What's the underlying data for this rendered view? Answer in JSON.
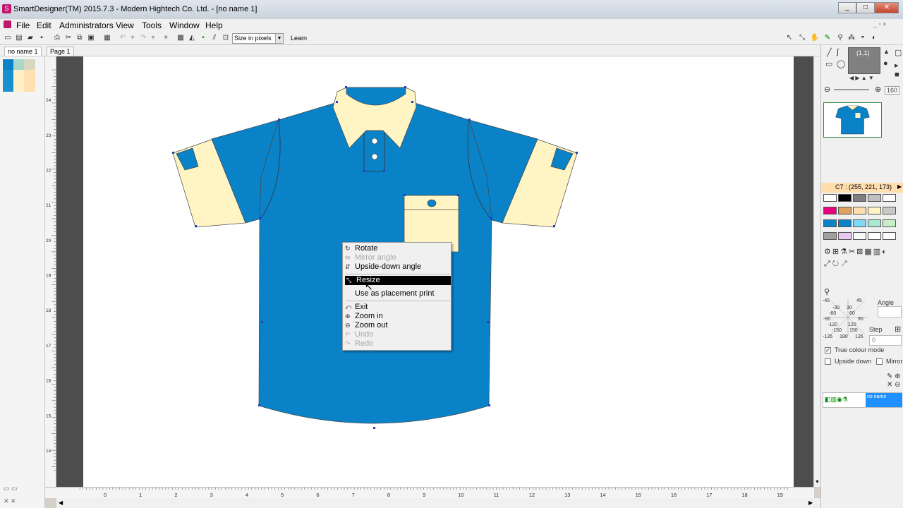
{
  "window": {
    "title": "SmartDesigner(TM) 2015.7.3 - Modern Hightech Co. Ltd. - [no name 1]",
    "controls": [
      "_",
      "□",
      "✕"
    ]
  },
  "menubar": [
    "File",
    "Edit",
    "Administrators",
    "View",
    "Tools",
    "Window",
    "Help"
  ],
  "toolbar": {
    "size_mode": "Size in pixels",
    "learn": "Learn"
  },
  "tabs": [
    "no name 1",
    "Page 1"
  ],
  "rulers": {
    "horizontal": [
      "0",
      "1",
      "2",
      "3",
      "4",
      "5",
      "6",
      "7",
      "8",
      "9",
      "10",
      "11",
      "12",
      "13",
      "14",
      "15",
      "16",
      "17",
      "18",
      "19"
    ],
    "vertical": [
      "24",
      "23",
      "22",
      "21",
      "20",
      "19",
      "18",
      "17",
      "16",
      "15",
      "14"
    ]
  },
  "context_menu": {
    "items": [
      {
        "label": "Rotate",
        "icon": "rotate-icon",
        "disabled": false
      },
      {
        "label": "Mirror angle",
        "icon": "mirror-icon",
        "disabled": true
      },
      {
        "label": "Upside-down angle",
        "icon": "upside-down-icon",
        "disabled": false
      },
      {
        "label": "Resize",
        "icon": "resize-icon",
        "disabled": false,
        "selected": true
      },
      {
        "label": "Use as placement print",
        "icon": "",
        "disabled": false
      },
      {
        "label": "Exit",
        "icon": "exit-icon",
        "disabled": false
      },
      {
        "label": "Zoom in",
        "icon": "zoom-in-icon",
        "disabled": false
      },
      {
        "label": "Zoom out",
        "icon": "zoom-out-icon",
        "disabled": false
      },
      {
        "label": "Undo",
        "icon": "undo-icon",
        "disabled": true
      },
      {
        "label": "Redo",
        "icon": "redo-icon",
        "disabled": true
      }
    ]
  },
  "right_panel": {
    "coord": "(1,1)",
    "zoom": "160",
    "color_info": "C7 : (255, 221, 173)",
    "angle_label": "Angle",
    "step_label": "Step",
    "step_value": "0",
    "dial_labels": [
      "-45",
      "45",
      "-30",
      "30",
      "-60",
      "60",
      "-90",
      "90",
      "-120",
      "120",
      "-150",
      "150",
      "-135",
      "180",
      "135"
    ],
    "true_colour": "True colour mode",
    "upside_down": "Upside down",
    "mirror": "Mirror",
    "layer_name": "no name"
  },
  "colors": {
    "shirt_blue": "#0a82c8",
    "shirt_cream": "#fff5c4",
    "selection": "#000000",
    "palette": [
      "#ffffff",
      "#000000",
      "#7f7f7f",
      "#bfbfbf",
      "#ffffff",
      "#e6007e",
      "#e0a060",
      "#ffddad",
      "#fff5c4",
      "#c8c8c8",
      "#0a82c8",
      "#0a82c8",
      "#80d8f8",
      "#a8e8d0",
      "#c8f0c8",
      "#a0a0a0",
      "#e8c8f0",
      "#f8f8f8",
      "#ffffff",
      "#ffffff"
    ]
  }
}
